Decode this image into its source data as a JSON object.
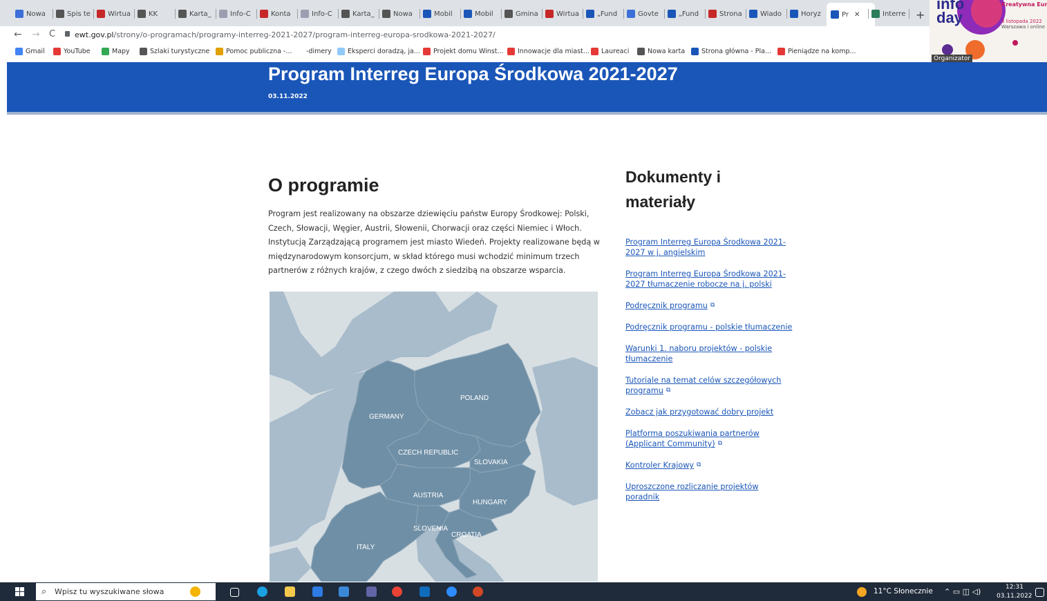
{
  "browser": {
    "tabs": [
      {
        "label": "Nowa",
        "icon": "wp-icon",
        "color": "#3c6fd8"
      },
      {
        "label": "Spis te",
        "icon": "globe-icon",
        "color": "#555555"
      },
      {
        "label": "Wirtua",
        "icon": "wp-icon",
        "color": "#c62828"
      },
      {
        "label": "KK",
        "icon": "globe-icon",
        "color": "#555555"
      },
      {
        "label": "Karta_",
        "icon": "globe-icon",
        "color": "#555555"
      },
      {
        "label": "Info-C",
        "icon": "info-icon",
        "color": "#9e9eb0"
      },
      {
        "label": "Konta",
        "icon": "gov-icon",
        "color": "#c62828"
      },
      {
        "label": "Info-C",
        "icon": "info-icon",
        "color": "#9e9eb0"
      },
      {
        "label": "Karta_",
        "icon": "globe-icon",
        "color": "#555555"
      },
      {
        "label": "Nowa",
        "icon": "globe-icon",
        "color": "#555555"
      },
      {
        "label": "Mobil",
        "icon": "ewt-icon",
        "color": "#1a56b8"
      },
      {
        "label": "Mobil",
        "icon": "ewt-icon",
        "color": "#1a56b8"
      },
      {
        "label": "Gmina",
        "icon": "globe-icon",
        "color": "#555555"
      },
      {
        "label": "Wirtua",
        "icon": "wp-icon",
        "color": "#c62828"
      },
      {
        "label": "„Fund",
        "icon": "ewt-icon",
        "color": "#1a56b8"
      },
      {
        "label": "Govte",
        "icon": "govtech-icon",
        "color": "#3c6fd8"
      },
      {
        "label": "„Fund",
        "icon": "ewt-icon",
        "color": "#1a56b8"
      },
      {
        "label": "Strona",
        "icon": "strona-icon",
        "color": "#c62828"
      },
      {
        "label": "Wiado",
        "icon": "ewt-icon",
        "color": "#1a56b8"
      },
      {
        "label": "Horyz",
        "icon": "eu-icon",
        "color": "#1a56b8"
      },
      {
        "label": "Pr",
        "icon": "ewt-icon",
        "color": "#1a56b8",
        "active": true
      },
      {
        "label": "Interre",
        "icon": "interreg-icon",
        "color": "#2a7d5a"
      }
    ],
    "url_domain": "ewt.gov.pl",
    "url_path": "/strony/o-programach/programy-interreg-2021-2027/program-interreg-europa-srodkowa-2021-2027/",
    "bookmarks": [
      {
        "label": "Gmail",
        "icon": "google-icon",
        "color": "#4285f4"
      },
      {
        "label": "YouTube",
        "icon": "youtube-icon",
        "color": "#e53935"
      },
      {
        "label": "Mapy",
        "icon": "maps-icon",
        "color": "#34a853"
      },
      {
        "label": "Szlaki turystyczne",
        "icon": "globe-icon",
        "color": "#555555"
      },
      {
        "label": "Pomoc publiczna -...",
        "icon": "exclamation-icon",
        "color": "#e0a000"
      },
      {
        "label": "-dimery",
        "icon": "blank-icon",
        "color": "#ffffff"
      },
      {
        "label": "Eksperci doradzą, ja...",
        "icon": "cloud-icon",
        "color": "#90caf9"
      },
      {
        "label": "Projekt domu Winst...",
        "icon": "house-icon",
        "color": "#e53935"
      },
      {
        "label": "Innowacje dla miast...",
        "icon": "doc-icon",
        "color": "#e53935"
      },
      {
        "label": "Laureaci",
        "icon": "laureaci-icon",
        "color": "#e53935"
      },
      {
        "label": "Nowa karta",
        "icon": "globe-icon",
        "color": "#555555"
      },
      {
        "label": "Strona główna - Pla...",
        "icon": "pl-icon",
        "color": "#1a56b8"
      },
      {
        "label": "Pieniądze na komp...",
        "icon": "money-icon",
        "color": "#e53935"
      }
    ]
  },
  "ad": {
    "title_line1": "info",
    "title_line2": "day",
    "top_text": "Kreatywna Europ",
    "line_a": "3 listopada 2022",
    "line_b": "Warszawa i online",
    "organizer": "Organizator"
  },
  "hero": {
    "title": "Program Interreg Europa Środkowa 2021-2027",
    "date": "03.11.2022"
  },
  "about": {
    "heading": "O programie",
    "body": "Program jest realizowany na obszarze dziewięciu państw Europy Środkowej: Polski, Czech, Słowacji, Węgier, Austrii, Słowenii, Chorwacji oraz części Niemiec i Włoch. Instytucją Zarządzającą programem jest miasto Wiedeń. Projekty realizowane będą w międzynarodowym konsorcjum, w skład którego musi wchodzić minimum trzech partnerów z różnych krajów, z czego dwóch z siedzibą na obszarze wsparcia."
  },
  "map": {
    "countries": [
      "POLAND",
      "GERMANY",
      "CZECH REPUBLIC",
      "SLOVAKIA",
      "AUSTRIA",
      "HUNGARY",
      "SLOVENIA",
      "CROATIA",
      "ITALY"
    ]
  },
  "documents": {
    "heading": "Dokumenty i materiały",
    "links": [
      {
        "label": "Program Interreg Europa Środkowa 2021-2027 w j. angielskim",
        "external": false
      },
      {
        "label": "Program Interreg Europa Środkowa 2021-2027 tłumaczenie robocze na j. polski",
        "external": false
      },
      {
        "label": "Podręcznik programu",
        "external": true
      },
      {
        "label": "Podręcznik programu - polskie tłumaczenie",
        "external": false
      },
      {
        "label": "Warunki 1. naboru projektów - polskie tłumaczenie",
        "external": false
      },
      {
        "label": "Tutoriale na temat celów szczegółowych programu",
        "external": true
      },
      {
        "label": "Zobacz jak przygotować dobry projekt",
        "external": false
      },
      {
        "label": "Platforma poszukiwania partnerów (Applicant Community)",
        "external": true
      },
      {
        "label": "Kontroler Krajowy",
        "external": true
      },
      {
        "label": "Uproszczone rozliczanie projektów poradnik",
        "external": false
      }
    ]
  },
  "taskbar": {
    "search_placeholder": "Wpisz tu wyszukiwane słowa",
    "weather": "11°C  Słonecznie",
    "time": "12:31",
    "date": "03.11.2022"
  },
  "colors": {
    "hero_blue": "#1a56b8",
    "map_land": "#6f8fa6",
    "map_bg_land": "#a9bccb",
    "map_sea": "#d7dfe3"
  }
}
